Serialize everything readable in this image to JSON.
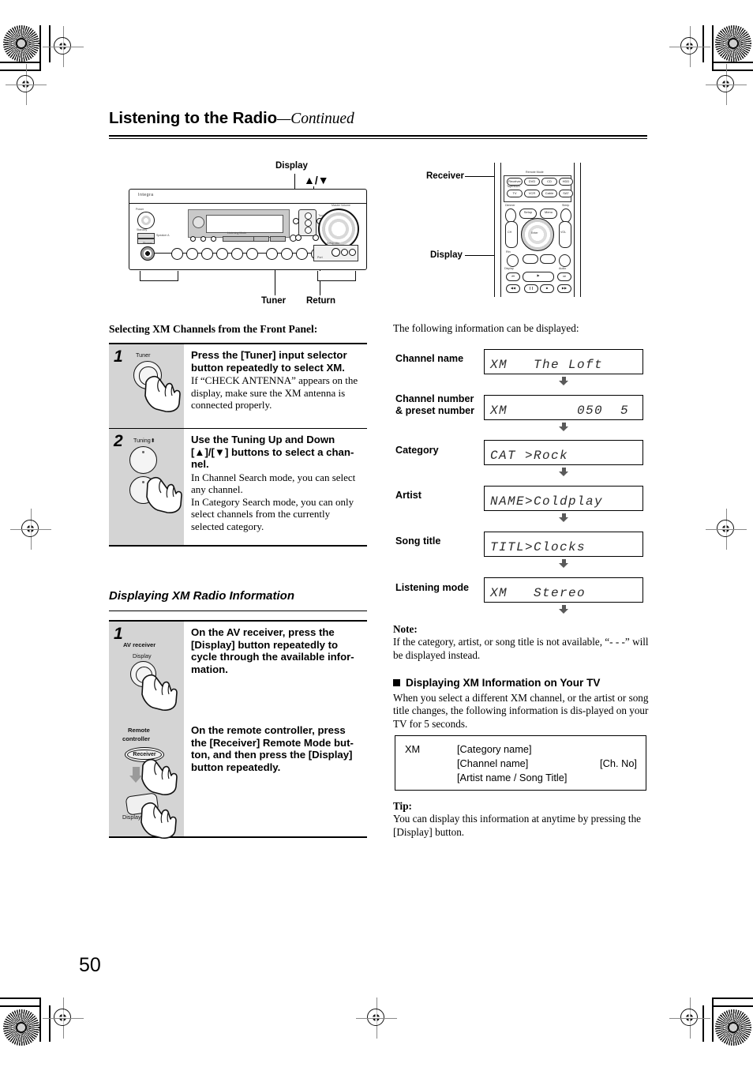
{
  "page": {
    "title_main": "Listening to the Radio",
    "title_cont": "—Continued",
    "number": "50"
  },
  "receiver_diagram": {
    "callouts": {
      "display": "Display",
      "updown": "▲/▼",
      "tuner": "Tuner",
      "return": "Return"
    },
    "brand": "Integra",
    "micro_labels": {
      "power": "Power",
      "standby": "Standby",
      "speaker_a": "Speaker A",
      "speaker_b": "Speaker B",
      "setup": "Setup",
      "listening": "Listening Mode",
      "memory": "Memory",
      "tuning": "Tuning",
      "master_volume": "Master Volume",
      "phones": "Phones",
      "input_1": "MULTI CH",
      "input_2": "DVD",
      "input_3": "VIDEO 1",
      "input_4": "VIDEO 2",
      "input_5": "VIDEO 3",
      "input_6": "TAPE",
      "input_7": "CD",
      "input_8": "TUNER",
      "input_9": "TV",
      "input_10": "PHONO",
      "setup_mic": "Setup Mic",
      "port_label": "Port"
    }
  },
  "remote_diagram": {
    "callouts": {
      "receiver": "Receiver",
      "display": "Display"
    },
    "micro_labels": {
      "remote_mode": "Remote Mode",
      "receiver": "Receiver",
      "tape_mdr": "Tape/MDR",
      "dvd": "DVD",
      "cd": "CD",
      "hdd": "HDD",
      "tv": "TV",
      "vcr": "VCR",
      "cable": "Cable",
      "sat": "SAT",
      "dimmer": "Dimmer",
      "sleep": "Sleep",
      "setup": "Setup",
      "menu": "Menu",
      "enter": "Enter",
      "ch": "CH",
      "vol": "VOL",
      "rtn": "Rtn",
      "display": "Display",
      "audio": "Audio"
    }
  },
  "front_panel_section": {
    "heading": "Selecting XM Channels from the Front Panel:",
    "steps": [
      {
        "number": "1",
        "icon_label": "Tuner",
        "head": "Press the [Tuner] input selector button repeatedly to select XM.",
        "body": "If “CHECK ANTENNA” appears on the display, make sure the XM antenna is connected properly."
      },
      {
        "number": "2",
        "icon_label": "Tuning",
        "head": "Use the Tuning Up and Down [▲]/[▼] buttons to select a chan-nel.",
        "body": "In Channel Search mode, you can select any channel.\nIn Category Search mode, you can only select channels from the currently selected category."
      }
    ]
  },
  "display_info_section": {
    "heading": "Displaying XM Radio Information",
    "step": {
      "number": "1",
      "icon_labels": {
        "av_receiver": "AV receiver",
        "display_top": "Display",
        "remote_controller_line1": "Remote",
        "remote_controller_line2": "controller",
        "receiver_button": "Receiver",
        "display_bottom": "Display"
      },
      "para1": "On the AV receiver, press the [Display] button repeatedly to cycle through the available infor-mation.",
      "para2": "On the remote controller, press the [Receiver] Remote Mode but-ton, and then press the [Display] button repeatedly."
    }
  },
  "right_column": {
    "intro": "The following information can be displayed:",
    "lcd_rows": [
      {
        "label": "Channel name",
        "label2": "",
        "display": "XM   The Loft"
      },
      {
        "label": "Channel number",
        "label2": "& preset number",
        "display": "XM        050  5"
      },
      {
        "label": "Category",
        "label2": "",
        "display": "CAT >Rock"
      },
      {
        "label": "Artist",
        "label2": "",
        "display": "NAME>Coldplay"
      },
      {
        "label": "Song title",
        "label2": "",
        "display": "TITL>Clocks"
      },
      {
        "label": "Listening mode",
        "label2": "",
        "display": "XM   Stereo"
      }
    ],
    "note": {
      "head": "Note:",
      "text": "If the category, artist, or song title is not available, “- - -” will be displayed instead."
    },
    "tv_section": {
      "head": "Displaying XM Information on Your TV",
      "text": "When you select a different XM channel, or the artist or song title changes, the following information is dis-played on your TV for 5 seconds.",
      "box": {
        "xm": "XM",
        "line1": "[Category name]",
        "line2": "[Channel name]",
        "line3": "[Artist name / Song Title]",
        "ch_no": "[Ch. No]"
      }
    },
    "tip": {
      "head": "Tip:",
      "text": "You can display this information at anytime by pressing the [Display] button."
    }
  }
}
